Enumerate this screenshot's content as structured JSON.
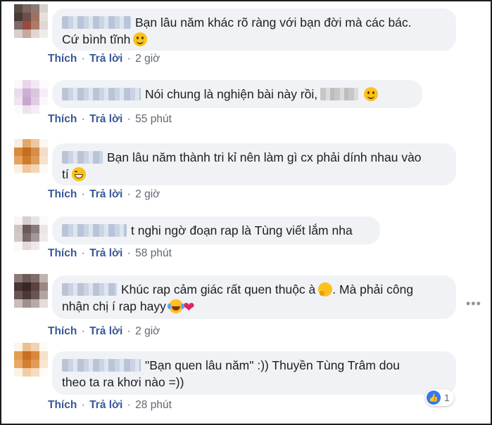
{
  "action_labels": {
    "like": "Thích",
    "reply": "Trả lời"
  },
  "comments": [
    {
      "line1": "Bạn lâu năm khác rõ ràng với bạn đời mà các bác.",
      "line2": "Cứ bình tĩnh",
      "time": "2 giờ"
    },
    {
      "line1": "Nói chung là nghiện bài này rồi,",
      "time": "55 phút"
    },
    {
      "line1": "Bạn lâu năm thành tri kỉ nên làm gì cx phải dính nhau vào",
      "line2": "tí",
      "time": "2 giờ"
    },
    {
      "line1": "t nghi ngờ đoạn rap là Tùng viết lắm nha",
      "time": "58 phút"
    },
    {
      "line1": "Khúc rap cảm giác rất quen thuộc à",
      "line1b": ". Mà phải công",
      "line2": "nhận chị í rap hayy",
      "time": "2 giờ"
    },
    {
      "line1": "\"Bạn quen lâu năm\" :)) Thuyền Tùng Trâm dou",
      "line2": "theo ta ra khơi nào =))",
      "time": "28 phút",
      "reaction_count": "1"
    }
  ],
  "colors": {
    "link": "#385898",
    "bubble": "#f0f2f5",
    "like_badge": "#2f7af5"
  },
  "icons": [
    "smile-emoji",
    "grin-emoji",
    "thinking-emoji",
    "laugh-cry-emoji",
    "heart-emoji",
    "like-icon",
    "more-options-icon"
  ]
}
